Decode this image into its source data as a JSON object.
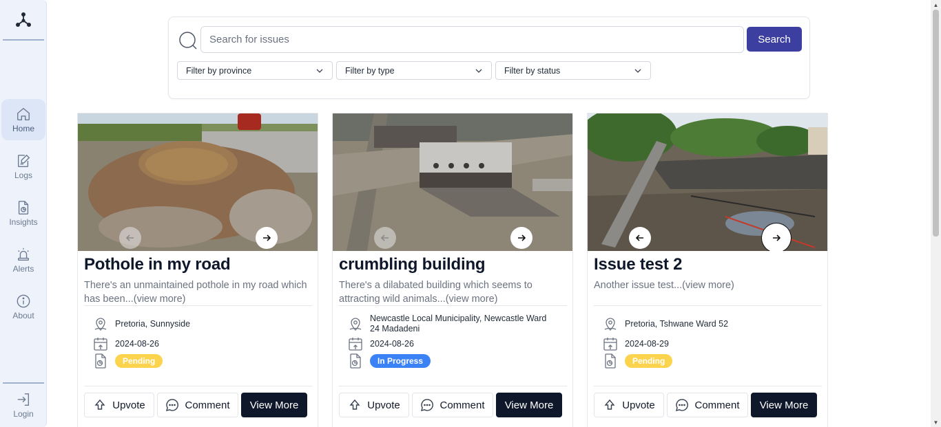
{
  "sidebar": {
    "logo_icon": "triad-logo-icon",
    "items": [
      {
        "label": "Home",
        "icon": "home-icon",
        "active": true
      },
      {
        "label": "Logs",
        "icon": "edit-note-icon",
        "active": false
      },
      {
        "label": "Insights",
        "icon": "file-chart-icon",
        "active": false
      },
      {
        "label": "Alerts",
        "icon": "siren-icon",
        "active": false
      },
      {
        "label": "About",
        "icon": "info-icon",
        "active": false
      }
    ],
    "login": {
      "label": "Login",
      "icon": "login-icon"
    }
  },
  "search": {
    "placeholder": "Search for issues",
    "button_label": "Search",
    "filters": [
      {
        "label": "Filter by province"
      },
      {
        "label": "Filter by type"
      },
      {
        "label": "Filter by status"
      }
    ]
  },
  "cards": [
    {
      "title": "Pothole in my road",
      "description": "There's an unmaintained pothole in my road which has been...(view more)",
      "location": "Pretoria, Sunnyside",
      "date": "2024-08-26",
      "status": "Pending",
      "status_color": "#fcd34d",
      "actions": {
        "upvote": "Upvote",
        "comment": "Comment",
        "view": "View More"
      }
    },
    {
      "title": "crumbling building",
      "description": "There's a dilabated building which seems to attracting wild animals...(view more)",
      "location": "Newcastle Local Municipality, Newcastle Ward 24 Madadeni",
      "date": "2024-08-26",
      "status": "In Progress",
      "status_color": "#3b82f6",
      "actions": {
        "upvote": "Upvote",
        "comment": "Comment",
        "view": "View More"
      }
    },
    {
      "title": "Issue test 2",
      "description": "Another issue test...(view more)",
      "location": "Pretoria, Tshwane Ward 52",
      "date": "2024-08-29",
      "status": "Pending",
      "status_color": "#fcd34d",
      "actions": {
        "upvote": "Upvote",
        "comment": "Comment",
        "view": "View More"
      }
    }
  ],
  "colors": {
    "accent": "#3c3fa0",
    "dark_button": "#0f172a",
    "sidebar_bg": "#eef2fb"
  }
}
